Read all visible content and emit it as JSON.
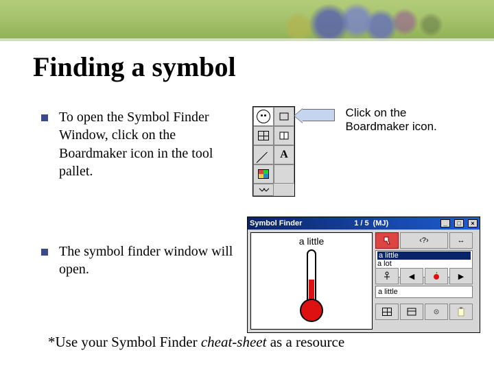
{
  "title": "Finding a symbol",
  "bullets": [
    "To open the Symbol Finder Window, click on the Boardmaker icon in the tool pallet.",
    "The symbol finder window will open."
  ],
  "callout": "Click on the Boardmaker icon.",
  "tool_palette": {
    "cells": [
      "face",
      "square",
      "grid",
      "grid-split",
      "diagonal",
      "A",
      "colors",
      "blank",
      "arrows-down",
      ""
    ]
  },
  "symbol_finder": {
    "title": "Symbol Finder",
    "page_indicator": "1 / 5",
    "tag": "(MJ)",
    "symbol_name": "a little",
    "list_items": [
      "a little",
      "a lot"
    ],
    "input_value": "a little",
    "bottom_icons": [
      "person",
      "prev",
      "apple",
      "next",
      "grid",
      "layout",
      "settings",
      "clipboard"
    ],
    "top_icons": [
      "thumb-down",
      "question",
      "swap"
    ]
  },
  "footnote_prefix": "*Use your Symbol Finder ",
  "footnote_em": "cheat-sheet",
  "footnote_suffix": " as a resource"
}
